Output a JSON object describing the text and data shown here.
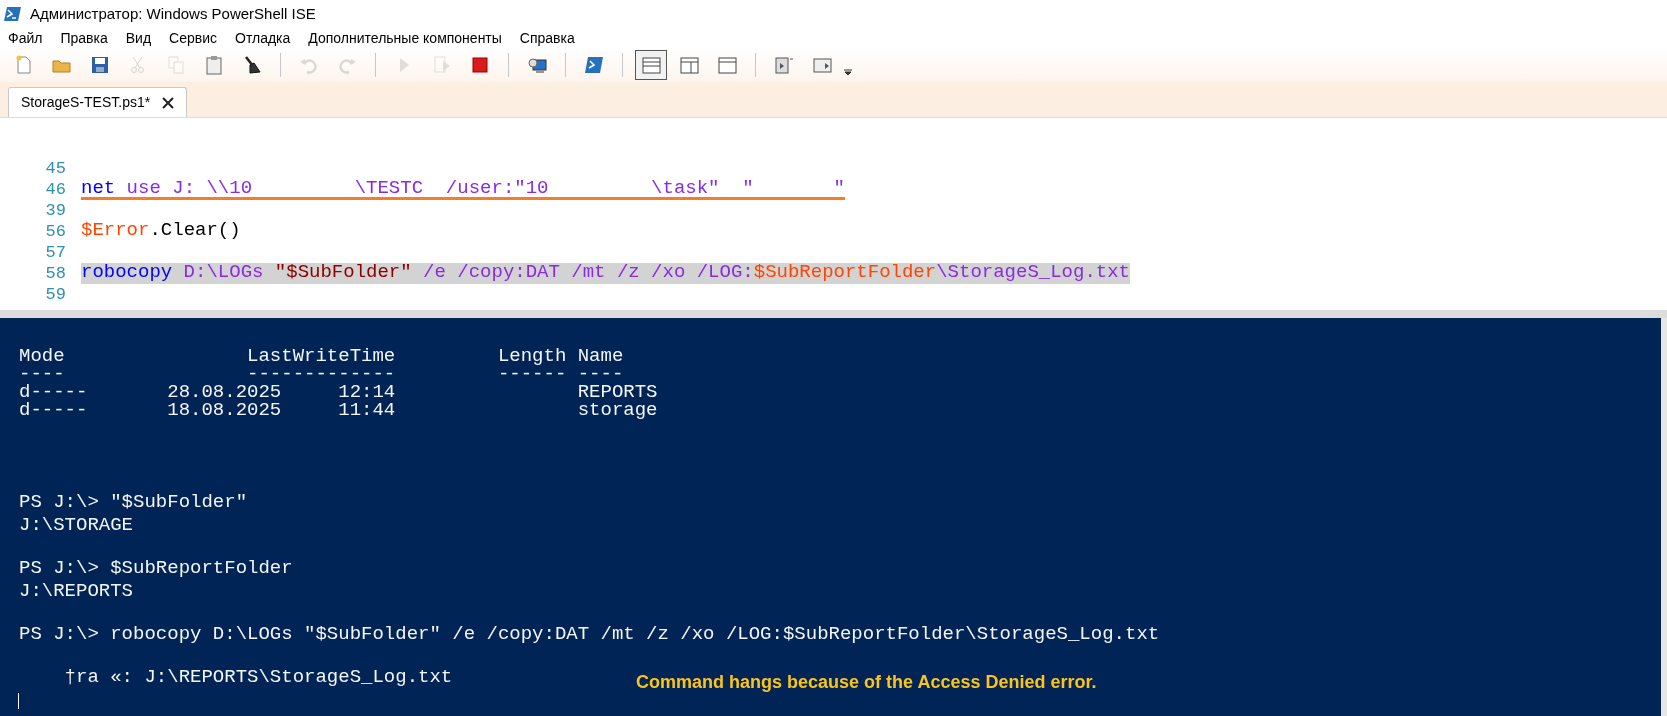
{
  "window": {
    "title": "Администратор: Windows PowerShell ISE"
  },
  "menu": [
    "Файл",
    "Правка",
    "Вид",
    "Сервис",
    "Отладка",
    "Дополнительные компоненты",
    "Справка"
  ],
  "toolbar": [
    {
      "kind": "new",
      "disabled": false
    },
    {
      "kind": "open",
      "disabled": false
    },
    {
      "kind": "save",
      "disabled": false
    },
    {
      "kind": "cut",
      "disabled": true
    },
    {
      "kind": "copy",
      "disabled": true
    },
    {
      "kind": "paste",
      "disabled": false
    },
    {
      "kind": "clear",
      "disabled": false
    },
    {
      "kind": "sep"
    },
    {
      "kind": "undo",
      "disabled": true
    },
    {
      "kind": "redo",
      "disabled": true
    },
    {
      "kind": "sep"
    },
    {
      "kind": "run",
      "disabled": true
    },
    {
      "kind": "run-selection",
      "disabled": true
    },
    {
      "kind": "stop",
      "disabled": false
    },
    {
      "kind": "sep"
    },
    {
      "kind": "remote",
      "disabled": false
    },
    {
      "kind": "sep"
    },
    {
      "kind": "console",
      "disabled": false
    },
    {
      "kind": "sep"
    },
    {
      "kind": "layout-top",
      "selected": true
    },
    {
      "kind": "layout-right",
      "selected": false
    },
    {
      "kind": "layout-max",
      "selected": false
    },
    {
      "kind": "sep"
    },
    {
      "kind": "show-commands",
      "disabled": false
    },
    {
      "kind": "show-addon",
      "disabled": false
    },
    {
      "kind": "more"
    }
  ],
  "tabs": [
    {
      "label": "StorageS-TEST.ps1*",
      "selected": true
    }
  ],
  "editor": {
    "lines": [
      {
        "number": "45"
      },
      {
        "number": "46",
        "highlighted": false,
        "error": true,
        "tokens": [
          {
            "kind": "command",
            "text": "net"
          },
          {
            "kind": "argument",
            "text": " use J: \\\\10         \\TESTC  /user:\"10         \\task\"  \""
          },
          {
            "kind": "argument",
            "text": "       \""
          }
        ]
      },
      {
        "number": "39"
      },
      {
        "number": "56",
        "highlighted": false,
        "error": false,
        "tokens": [
          {
            "kind": "variable",
            "text": "$Error"
          },
          {
            "kind": "plain",
            "text": ".Clear()"
          }
        ]
      },
      {
        "number": "57"
      },
      {
        "number": "58",
        "highlighted": true,
        "error": false,
        "tokens": [
          {
            "kind": "command",
            "text": "robocopy"
          },
          {
            "kind": "argument",
            "text": " D:\\LOGs "
          },
          {
            "kind": "string",
            "text": "\"$SubFolder\""
          },
          {
            "kind": "argument",
            "text": " /e /copy:DAT /mt /z /xo /LOG:"
          },
          {
            "kind": "variable",
            "text": "$SubReportFolder"
          },
          {
            "kind": "argument",
            "text": "\\StorageS_Log.txt"
          }
        ]
      },
      {
        "number": "59"
      }
    ]
  },
  "console": {
    "listing": [
      "Mode                LastWriteTime         Length Name",
      "----                -------------         ------ ----",
      "d-----       28.08.2025     12:14                REPORTS",
      "d-----       18.08.2025     11:44                storage"
    ],
    "blocks": [
      [
        "PS J:\\> \"$SubFolder\"",
        "J:\\STORAGE"
      ],
      [
        "PS J:\\> $SubReportFolder",
        "J:\\REPORTS"
      ],
      [
        "PS J:\\> robocopy D:\\LOGs \"$SubFolder\" /e /copy:DAT /mt /z /xo /LOG:$SubReportFolder\\StorageS_Log.txt"
      ],
      [
        "    †ra «: J:\\REPORTS\\StorageS_Log.txt"
      ]
    ],
    "annotation": "Command hangs because of the Access Denied error."
  }
}
